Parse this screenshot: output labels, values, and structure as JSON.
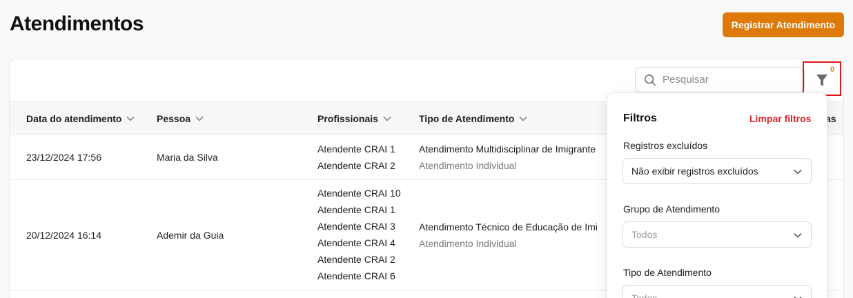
{
  "page": {
    "title": "Atendimentos",
    "primary_action_label": "Registrar Atendimento"
  },
  "search": {
    "placeholder": "Pesquisar"
  },
  "table": {
    "columns": [
      "Data do atendimento",
      "Pessoa",
      "Profissionais",
      "Tipo de Atendimento",
      "as"
    ],
    "rows": [
      {
        "date": "23/12/2024 17:56",
        "person": "Maria da Silva",
        "professionals": [
          "Atendente CRAI 1",
          "Atendente CRAI 2"
        ],
        "type": "Atendimento Multidisciplinar de Imigrante",
        "subtype": "Atendimento Individual"
      },
      {
        "date": "20/12/2024 16:14",
        "person": "Ademir da Guia",
        "professionals": [
          "Atendente CRAI 10",
          "Atendente CRAI 1",
          "Atendente CRAI 3",
          "Atendente CRAI 4",
          "Atendente CRAI 2",
          "Atendente CRAI 6"
        ],
        "type": "Atendimento Técnico de Educação de Imi",
        "subtype": "Atendimento Individual"
      }
    ]
  },
  "filter_button": {
    "count": "0",
    "icon": "filter-icon"
  },
  "filters_panel": {
    "title": "Filtros",
    "clear_label": "Limpar filtros",
    "fields": [
      {
        "label": "Registros excluídos",
        "value": "Não exibir registros excluídos"
      },
      {
        "label": "Grupo de Atendimento",
        "value": "Todos"
      },
      {
        "label": "Tipo de Atendimento",
        "value": "Todos"
      }
    ]
  },
  "colors": {
    "accent": "#dd7a0a",
    "danger": "#e0262b",
    "badge": "#e08a00"
  }
}
